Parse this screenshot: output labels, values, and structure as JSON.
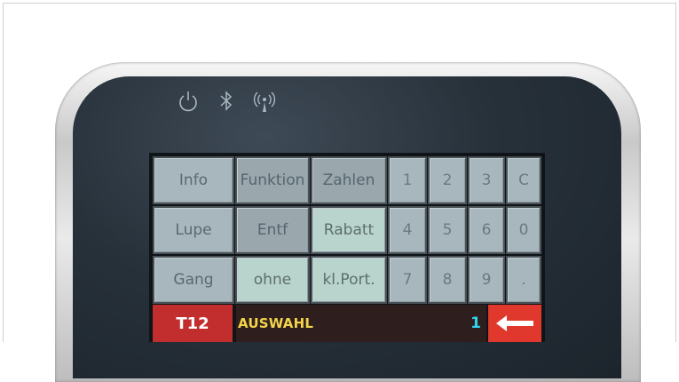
{
  "status_icons": [
    {
      "name": "power-icon"
    },
    {
      "name": "bluetooth-icon"
    },
    {
      "name": "wireless-icon"
    }
  ],
  "keypad": {
    "rows": [
      [
        "Info",
        "Funktion",
        "Zahlen",
        "1",
        "2",
        "3",
        "C"
      ],
      [
        "Lupe",
        "Entf",
        "Rabatt",
        "4",
        "5",
        "6",
        "0"
      ],
      [
        "Gang",
        "ohne",
        "kl.Port.",
        "7",
        "8",
        "9",
        "."
      ]
    ]
  },
  "bottom_bar": {
    "table_label": "T12",
    "status_text": "AUSWAHL",
    "count": "1",
    "back_icon": "arrow-left-icon"
  },
  "colors": {
    "key_gray": "#a8b6bd",
    "key_mint": "#b9d3cd",
    "table_red": "#c22d2d",
    "status_yellow": "#f2d34a",
    "count_cyan": "#2fd4ee",
    "back_red": "#e0382c"
  }
}
